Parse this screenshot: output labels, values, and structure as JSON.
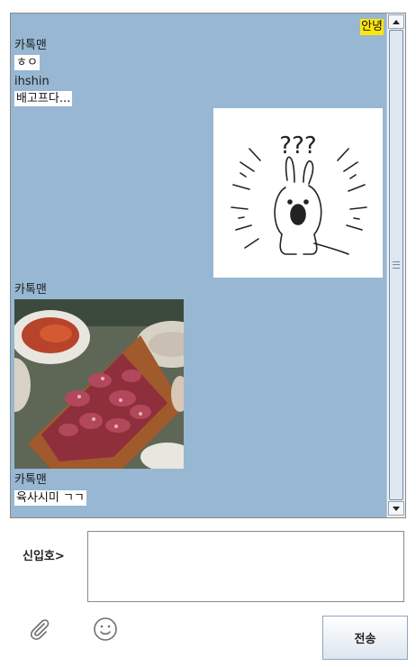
{
  "chat": {
    "my_message": "안녕",
    "messages": [
      {
        "name": "카톡맨",
        "text": "ㅎㅇ"
      },
      {
        "name": "ihshin",
        "text": "배고프다..."
      },
      {
        "name": "카톡맨",
        "image": "meat-photo"
      },
      {
        "name": "카톡맨",
        "text": "육사시미 ㄱㄱ"
      }
    ],
    "my_image": "confused-rabbit-sticker",
    "sticker_text": "???"
  },
  "composer": {
    "sender_label": "신입호>",
    "input_value": "",
    "send_label": "전송",
    "attach_icon": "paperclip-icon",
    "emoji_icon": "smiley-icon"
  },
  "colors": {
    "chat_bg": "#97b7d2",
    "my_bubble": "#ffe60a",
    "other_bubble": "#ffffff"
  }
}
